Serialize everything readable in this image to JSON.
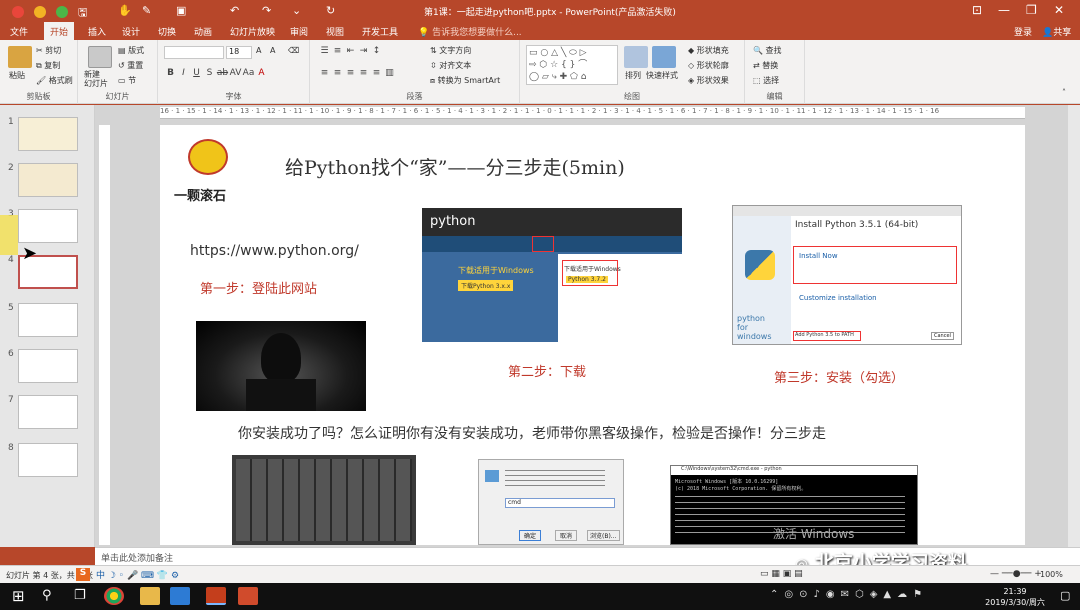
{
  "window": {
    "title": "第1课：一起走进python吧.pptx - PowerPoint(产品激活失败)"
  },
  "menu": {
    "tabs": [
      "文件",
      "开始",
      "插入",
      "设计",
      "切换",
      "动画",
      "幻灯片放映",
      "审阅",
      "视图",
      "开发工具"
    ],
    "active": "开始",
    "tell_me": "告诉我您想要做什么...",
    "login": "登录",
    "share": "共享"
  },
  "ribbon": {
    "clipboard": {
      "label": "剪贴板",
      "paste": "粘贴",
      "cut": "剪切",
      "copy": "复制",
      "format_painter": "格式刷"
    },
    "slides": {
      "label": "幻灯片",
      "new_slide": "新建\n幻灯片",
      "layout": "版式",
      "reset": "重置",
      "section": "节"
    },
    "font": {
      "label": "字体",
      "size": "18"
    },
    "paragraph": {
      "label": "段落",
      "text_direction": "文字方向",
      "align_text": "对齐文本",
      "smartart": "转换为 SmartArt"
    },
    "drawing": {
      "label": "绘图",
      "arrange": "排列",
      "quick_styles": "快速样式",
      "shape_fill": "形状填充",
      "shape_outline": "形状轮廓",
      "shape_effects": "形状效果"
    },
    "editing": {
      "label": "编辑",
      "find": "查找",
      "replace": "替换",
      "select": "选择"
    }
  },
  "ruler": {
    "h_ticks": "16 · 1 · 15 · 1 · 14 · 1 · 13 · 1 · 12 · 1 · 11 · 1 · 10 · 1 · 9 · 1 · 8 · 1 · 7 · 1 · 6 · 1 · 5 · 1 · 4 · 1 · 3 · 1 · 2 · 1 · 1 · 1 · 0 · 1 · 1 · 1 · 2 · 1 · 3 · 1 · 4 · 1 · 5 · 1 · 6 · 1 · 7 · 1 · 8 · 1 · 9 · 1 · 10 · 1 · 11 · 1 · 12 · 1 · 13 · 1 · 14 · 1 · 15 · 1 · 16"
  },
  "thumbnails": {
    "numbers": [
      "1",
      "2",
      "3",
      "4",
      "5",
      "6",
      "7",
      "8"
    ],
    "selected": 4
  },
  "slide": {
    "logo_text": "一颗滚石",
    "title": "给Python找个“家”——分三步走(5min)",
    "url": "https://www.python.org/",
    "step1": "第一步：登陆此网站",
    "step2": "第二步：下载",
    "step3": "第三步：安装（勾选）",
    "question": "你安装成功了吗？怎么证明你有没有安装成功，老师带你黑客级操作，检验是否操作！分三步走",
    "python_site": {
      "brand": "python",
      "download_title": "下载适用于Windows",
      "button": "下载Python 3.x.x",
      "panel_title": "下载适用于Windows",
      "panel_button": "Python 3.7.2"
    },
    "installer": {
      "title": "Install Python 3.5.1 (64-bit)",
      "install_now": "Install Now",
      "customize": "Customize installation",
      "path_option": "Add Python 3.5 to PATH",
      "brand": "python\nfor\nwindows",
      "cancel": "Cancel"
    },
    "cmd": {
      "title": "C:\\Windows\\system32\\cmd.exe - python",
      "line1": "Microsoft Windows [版本 10.0.16299]",
      "line2": "(c) 2018 Microsoft Corporation. 保留所有权利。"
    },
    "run_dialog": {
      "field_value": "cmd",
      "ok": "确定",
      "cancel": "取消",
      "browse": "浏览(B)..."
    }
  },
  "watermark": "激活 Windows",
  "notes": "单击此处添加备注",
  "status": {
    "slide_info": "幻灯片 第 4 张，共 8 张",
    "zoom": "100%"
  },
  "overlay_text": "北京小学学习资料",
  "taskbar": {
    "time": "21:39",
    "date": "2019/3/30/周六"
  }
}
